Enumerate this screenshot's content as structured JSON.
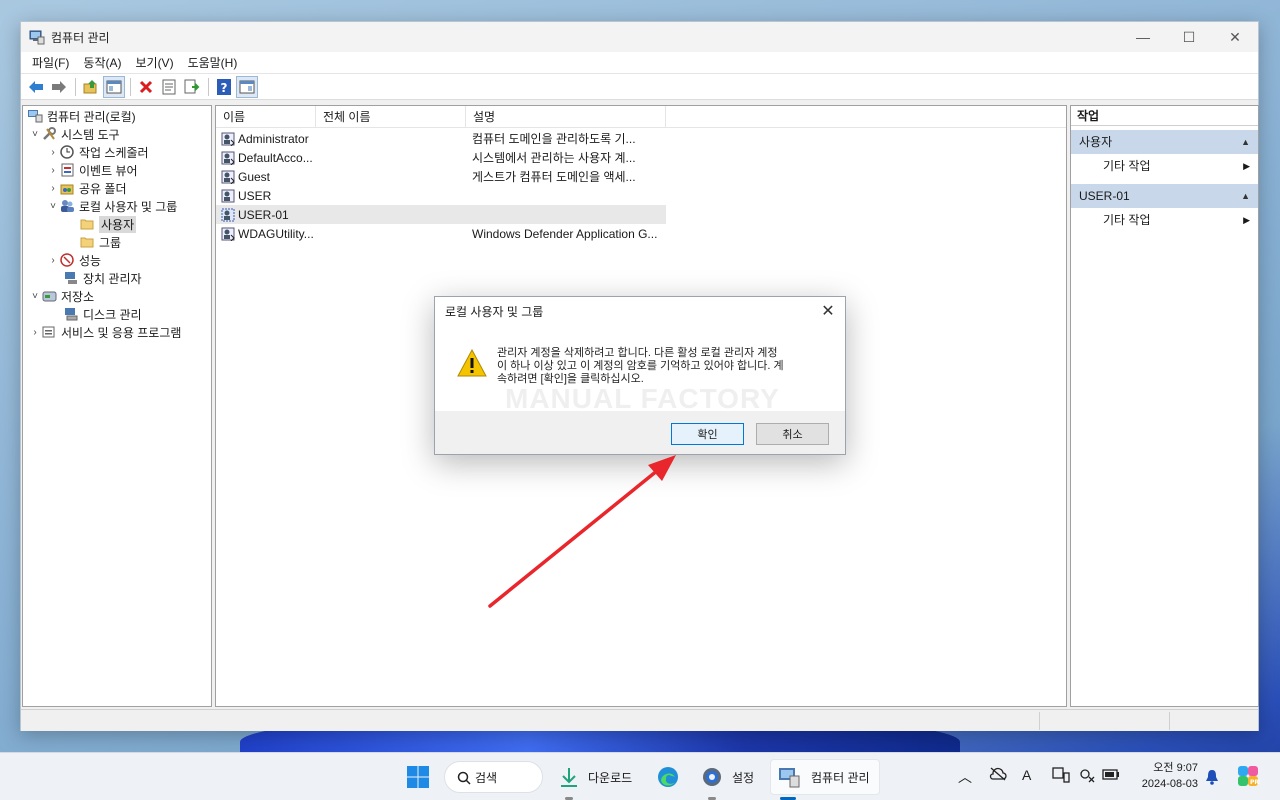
{
  "window": {
    "title": "컴퓨터 관리",
    "controls": {
      "minimize": "—",
      "maximize": "☐",
      "close": "✕"
    }
  },
  "menu": [
    "파일(F)",
    "동작(A)",
    "보기(V)",
    "도움말(H)"
  ],
  "tree": [
    {
      "label": "컴퓨터 관리(로컬)",
      "icon": "computer-management-icon",
      "arrow": ""
    },
    {
      "label": "시스템 도구",
      "icon": "tools-icon",
      "arrow": "˅"
    },
    {
      "label": "작업 스케줄러",
      "icon": "clock-icon",
      "arrow": "›"
    },
    {
      "label": "이벤트 뷰어",
      "icon": "event-viewer-icon",
      "arrow": "›"
    },
    {
      "label": "공유 폴더",
      "icon": "shared-folder-icon",
      "arrow": "›"
    },
    {
      "label": "로컬 사용자 및 그룹",
      "icon": "users-groups-icon",
      "arrow": "˅"
    },
    {
      "label": "사용자",
      "icon": "folder-icon",
      "arrow": ""
    },
    {
      "label": "그룹",
      "icon": "folder-icon",
      "arrow": ""
    },
    {
      "label": "성능",
      "icon": "performance-icon",
      "arrow": "›"
    },
    {
      "label": "장치 관리자",
      "icon": "device-manager-icon",
      "arrow": ""
    },
    {
      "label": "저장소",
      "icon": "storage-icon",
      "arrow": "˅"
    },
    {
      "label": "디스크 관리",
      "icon": "disk-management-icon",
      "arrow": ""
    },
    {
      "label": "서비스 및 응용 프로그램",
      "icon": "services-icon",
      "arrow": "›"
    }
  ],
  "list": {
    "columns": [
      "이름",
      "전체 이름",
      "설명"
    ],
    "rows": [
      {
        "name": "Administrator",
        "full_name": "",
        "description": "컴퓨터 도메인을 관리하도록 기..."
      },
      {
        "name": "DefaultAcco...",
        "full_name": "",
        "description": "시스템에서 관리하는 사용자 계..."
      },
      {
        "name": "Guest",
        "full_name": "",
        "description": "게스트가 컴퓨터 도메인을 액세..."
      },
      {
        "name": "USER",
        "full_name": "",
        "description": ""
      },
      {
        "name": "USER-01",
        "full_name": "",
        "description": ""
      },
      {
        "name": "WDAGUtility...",
        "full_name": "",
        "description": "Windows Defender Application G..."
      }
    ]
  },
  "actions": {
    "title": "작업",
    "sections": [
      {
        "header": "사용자",
        "item": "기타 작업"
      },
      {
        "header": "USER-01",
        "item": "기타 작업"
      }
    ]
  },
  "dialog": {
    "title": "로컬 사용자 및 그룹",
    "message_lines": [
      "관리자 계정을 삭제하려고 합니다. 다른 활성 로컬 관리자 계정",
      "이 하나 이상 있고 이 계정의 암호를 기억하고 있어야 합니다. 계",
      "속하려면 [확인]을 클릭하십시오."
    ],
    "watermark": "MANUAL FACTORY",
    "ok_label": "확인",
    "cancel_label": "취소"
  },
  "taskbar": {
    "search_label": "검색",
    "apps": [
      {
        "label": "다운로드",
        "icon": "download-icon"
      },
      {
        "label": "",
        "icon": "edge-icon"
      },
      {
        "label": "설정",
        "icon": "settings-icon"
      },
      {
        "label": "컴퓨터 관리",
        "icon": "computer-management-icon"
      }
    ],
    "clock_time": "오전 9:07",
    "clock_date": "2024-08-03"
  },
  "colors": {
    "accent": "#0078d7",
    "arrow": "#e8262c",
    "warning": "#f5c400",
    "action_header": "#c8d8ea"
  }
}
